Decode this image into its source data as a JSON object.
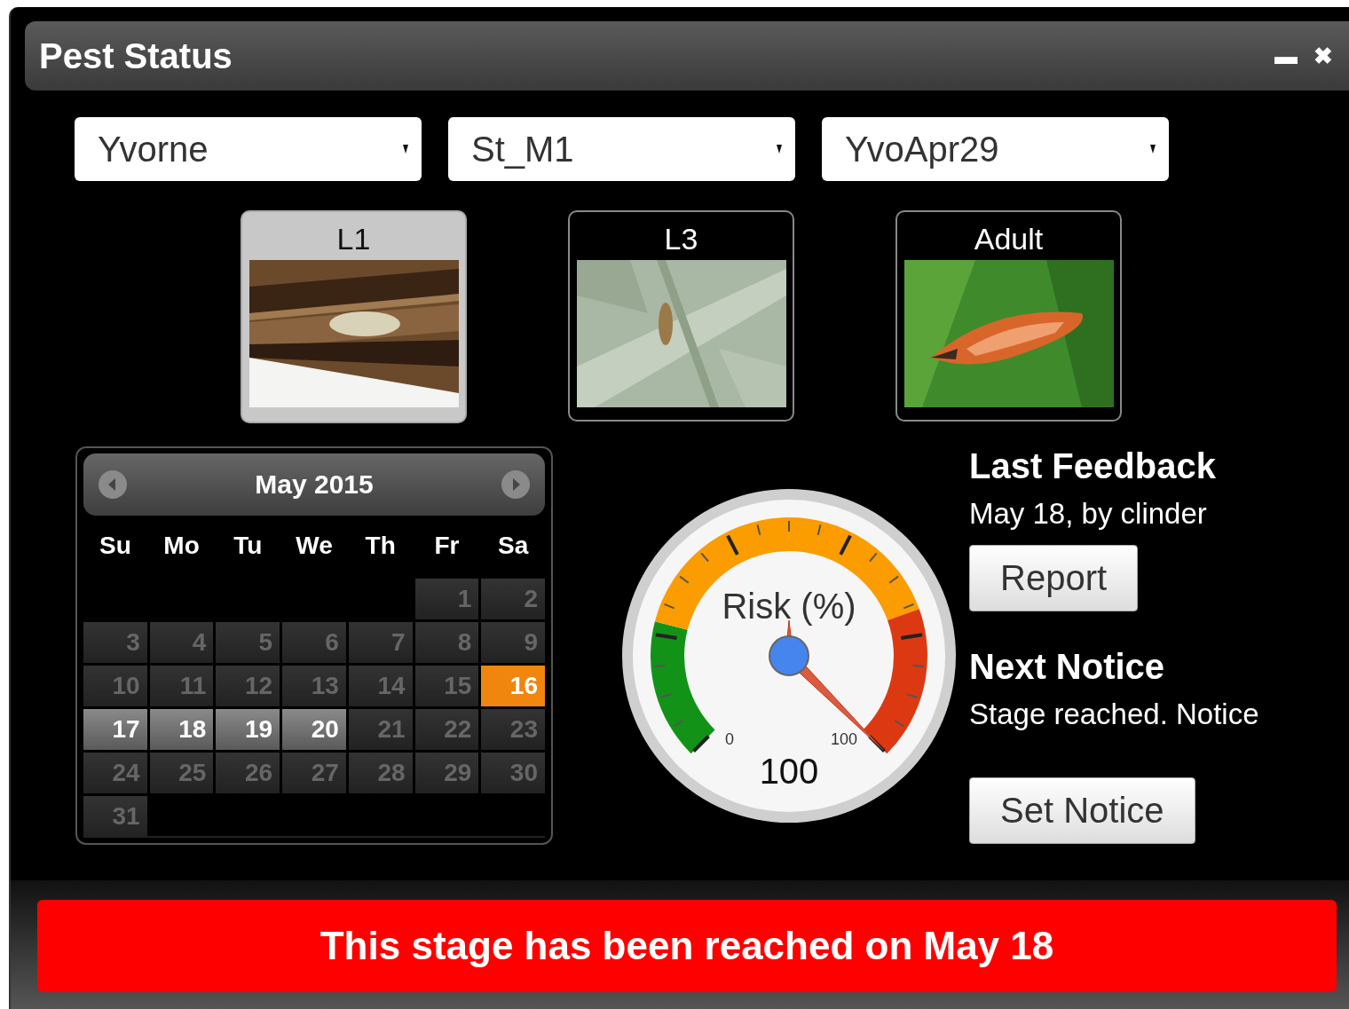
{
  "window": {
    "title": "Pest Status",
    "minimize": "▬",
    "close": "✖"
  },
  "dropdowns": [
    {
      "value": "Yvorne"
    },
    {
      "value": "St_M1"
    },
    {
      "value": "YvoApr29"
    }
  ],
  "stages": [
    {
      "label": "L1",
      "selected": true,
      "kind": "picture"
    },
    {
      "label": "L3",
      "selected": false,
      "kind": "picture"
    },
    {
      "label": "Adult",
      "selected": false,
      "kind": "picture"
    }
  ],
  "calendar": {
    "title": "May 2015",
    "weekdays": [
      "Su",
      "Mo",
      "Tu",
      "We",
      "Th",
      "Fr",
      "Sa"
    ],
    "weeks": [
      [
        {
          "kind": "blank"
        },
        {
          "kind": "blank"
        },
        {
          "kind": "blank"
        },
        {
          "kind": "blank"
        },
        {
          "kind": "blank"
        },
        {
          "kind": "normal",
          "day": "1"
        },
        {
          "kind": "normal",
          "day": "2"
        }
      ],
      [
        {
          "kind": "normal",
          "day": "3"
        },
        {
          "kind": "normal",
          "day": "4"
        },
        {
          "kind": "normal",
          "day": "5"
        },
        {
          "kind": "normal",
          "day": "6"
        },
        {
          "kind": "normal",
          "day": "7"
        },
        {
          "kind": "normal",
          "day": "8"
        },
        {
          "kind": "normal",
          "day": "9"
        }
      ],
      [
        {
          "kind": "normal",
          "day": "10"
        },
        {
          "kind": "normal",
          "day": "11"
        },
        {
          "kind": "normal",
          "day": "12"
        },
        {
          "kind": "normal",
          "day": "13"
        },
        {
          "kind": "normal",
          "day": "14"
        },
        {
          "kind": "normal",
          "day": "15"
        },
        {
          "kind": "today",
          "day": "16"
        }
      ],
      [
        {
          "kind": "marked",
          "day": "17"
        },
        {
          "kind": "marked",
          "day": "18"
        },
        {
          "kind": "marked",
          "day": "19"
        },
        {
          "kind": "marked",
          "day": "20"
        },
        {
          "kind": "normal",
          "day": "21"
        },
        {
          "kind": "normal",
          "day": "22"
        },
        {
          "kind": "normal",
          "day": "23"
        }
      ],
      [
        {
          "kind": "normal",
          "day": "24"
        },
        {
          "kind": "normal",
          "day": "25"
        },
        {
          "kind": "normal",
          "day": "26"
        },
        {
          "kind": "normal",
          "day": "27"
        },
        {
          "kind": "normal",
          "day": "28"
        },
        {
          "kind": "normal",
          "day": "29"
        },
        {
          "kind": "normal",
          "day": "30"
        }
      ],
      [
        {
          "kind": "normal",
          "day": "31"
        }
      ]
    ]
  },
  "gauge": {
    "label": "Risk (%)",
    "min_label": "0",
    "max_label": "100",
    "reading": "100"
  },
  "last_feedback": {
    "heading": "Last Feedback",
    "text": "May 18, by clinder",
    "button": "Report"
  },
  "next_notice": {
    "heading": "Next Notice",
    "text": "Stage reached. Notice",
    "button": "Set Notice"
  },
  "banner": "This stage has been reached on May 18"
}
